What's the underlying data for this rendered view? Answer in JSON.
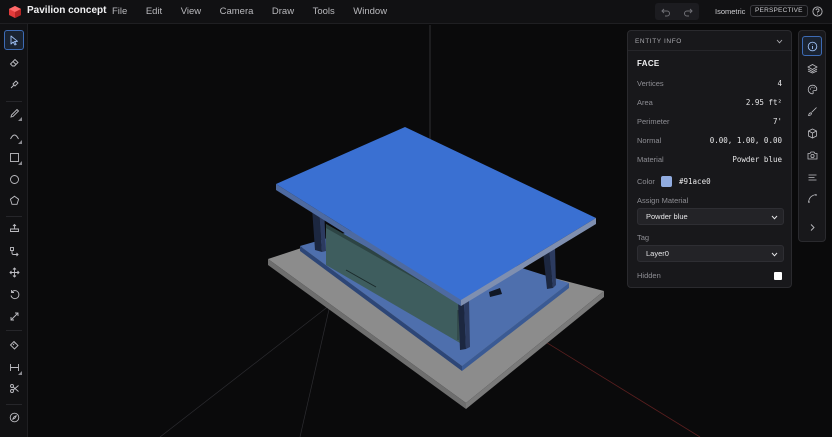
{
  "app": {
    "title": "Pavilion concept"
  },
  "menu": [
    "File",
    "Edit",
    "View",
    "Camera",
    "Draw",
    "Tools",
    "Window"
  ],
  "view": {
    "mode": "Isometric",
    "projection": "PERSPECTIVE"
  },
  "toolbar": {
    "tools": [
      {
        "name": "select-tool",
        "icon": "cursor-icon",
        "active": true
      },
      {
        "name": "eraser-tool",
        "icon": "eraser-icon"
      },
      {
        "name": "paint-tool",
        "icon": "paint-bucket-icon"
      },
      {
        "name": "pencil-tool",
        "icon": "pencil-icon"
      },
      {
        "name": "arc-tool",
        "icon": "arc-icon"
      },
      {
        "name": "rectangle-tool",
        "icon": "rectangle-icon"
      },
      {
        "name": "circle-tool",
        "icon": "circle-icon"
      },
      {
        "name": "polygon-tool",
        "icon": "pentagon-icon"
      },
      {
        "name": "push-pull-tool",
        "icon": "push-pull-icon"
      },
      {
        "name": "follow-me-tool",
        "icon": "follow-me-icon"
      },
      {
        "name": "move-tool",
        "icon": "move-icon"
      },
      {
        "name": "rotate-tool",
        "icon": "rotate-icon"
      },
      {
        "name": "scale-tool",
        "icon": "scale-icon"
      },
      {
        "name": "tape-measure-tool",
        "icon": "tape-measure-icon"
      },
      {
        "name": "dimension-tool",
        "icon": "dimension-icon"
      },
      {
        "name": "section-tool",
        "icon": "scissors-icon"
      },
      {
        "name": "orbit-tool",
        "icon": "compass-icon"
      }
    ]
  },
  "entity_info": {
    "header": "ENTITY INFO",
    "type": "FACE",
    "rows": [
      {
        "label": "Vertices",
        "value": "4"
      },
      {
        "label": "Area",
        "value": "2.95 ft²"
      },
      {
        "label": "Perimeter",
        "value": "7'"
      },
      {
        "label": "Normal",
        "value": "0.00, 1.00, 0.00"
      },
      {
        "label": "Material",
        "value": "Powder blue"
      }
    ],
    "color_label": "Color",
    "color_hex": "#91ace0",
    "assign_material_label": "Assign Material",
    "assign_material_value": "Powder blue",
    "tag_label": "Tag",
    "tag_value": "Layer0",
    "hidden_label": "Hidden",
    "hidden": false
  },
  "rail": [
    {
      "name": "entity-info-rail-button",
      "icon": "info-icon",
      "active": true
    },
    {
      "name": "layers-rail-button",
      "icon": "layers-icon"
    },
    {
      "name": "materials-rail-button",
      "icon": "palette-icon"
    },
    {
      "name": "styles-rail-button",
      "icon": "brush-icon"
    },
    {
      "name": "components-rail-button",
      "icon": "cube-icon"
    },
    {
      "name": "scenes-rail-button",
      "icon": "camera-icon"
    },
    {
      "name": "outliner-rail-button",
      "icon": "list-icon"
    },
    {
      "name": "curves-rail-button",
      "icon": "curve-icon"
    },
    {
      "name": "collapse-rail-button",
      "icon": "chevron-right-icon"
    }
  ],
  "colors": {
    "accent": "#3d6bb5",
    "roof": "#3a6fd0",
    "floor_slab": "#8a8a8a",
    "platform": "#4d6ea8",
    "glass": "#3c5a5a"
  }
}
